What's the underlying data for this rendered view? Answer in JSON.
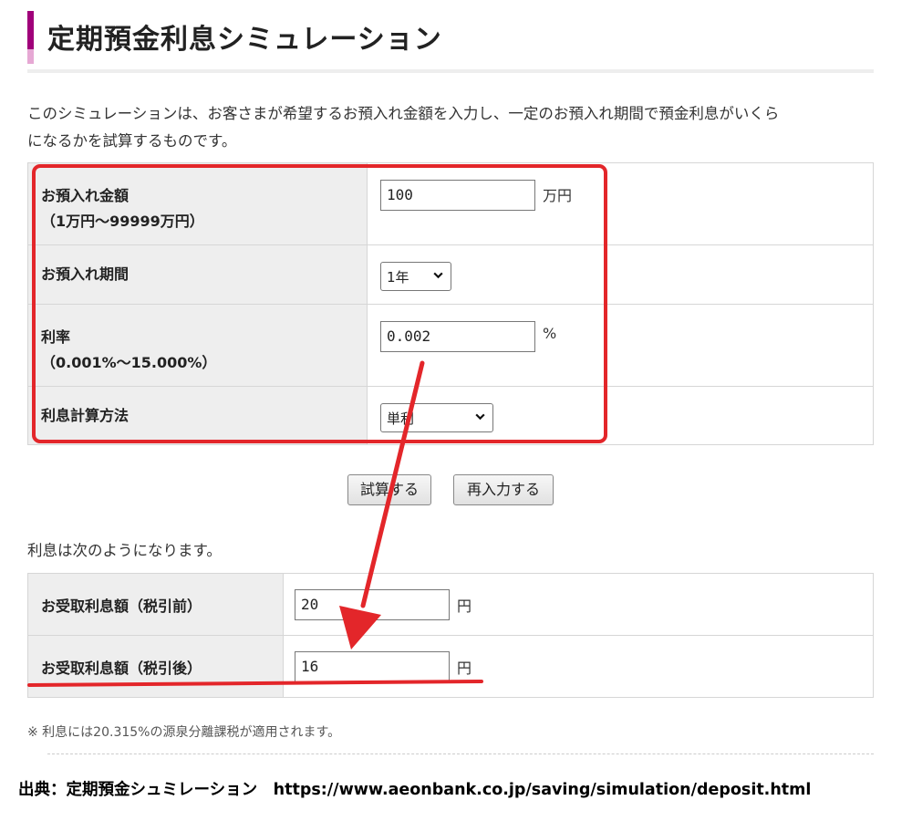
{
  "page": {
    "title": "定期預金利息シミュレーション",
    "intro_line1": "このシミュレーションは、お客さまが希望するお預入れ金額を入力し、一定のお預入れ期間で預金利息がいくら",
    "intro_line2": "になるかを試算するものです。"
  },
  "form": {
    "amount": {
      "label": "お預入れ金額",
      "sublabel": "（1万円～99999万円）",
      "value": "100",
      "unit": "万円"
    },
    "period": {
      "label": "お預入れ期間",
      "selected": "1年"
    },
    "rate": {
      "label": "利率",
      "sublabel": "（0.001%～15.000%）",
      "value": "0.002",
      "unit": "%"
    },
    "method": {
      "label": "利息計算方法",
      "selected": "単利"
    }
  },
  "buttons": {
    "calculate": "試算する",
    "reset": "再入力する"
  },
  "result": {
    "intro": "利息は次のようになります。",
    "before_tax": {
      "label": "お受取利息額（税引前）",
      "value": "20",
      "unit": "円"
    },
    "after_tax": {
      "label": "お受取利息額（税引後）",
      "value": "16",
      "unit": "円"
    }
  },
  "note": "※ 利息には20.315%の源泉分離課税が適用されます。",
  "source": "出典：定期預金シュミレーション　https://www.aeonbank.co.jp/saving/simulation/deposit.html",
  "colors": {
    "accent": "#a0007a",
    "annotation": "#e3262a",
    "label_bg": "#eeeeee"
  },
  "icons": {
    "select_arrow": "chevron-down-icon"
  }
}
